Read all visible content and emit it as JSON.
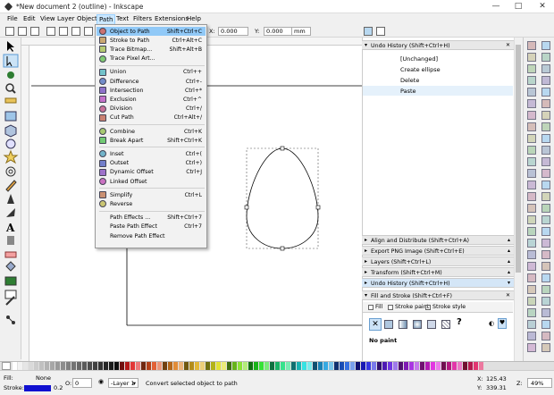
{
  "window": {
    "title": "*New document 2 (outline) - Inkscape",
    "controls": [
      "—",
      "□",
      "✕"
    ]
  },
  "menubar": [
    {
      "label": "File"
    },
    {
      "label": "Edit"
    },
    {
      "label": "View"
    },
    {
      "label": "Layer"
    },
    {
      "label": "Object"
    },
    {
      "label": "Path"
    },
    {
      "label": "Text"
    },
    {
      "label": "Filters"
    },
    {
      "label": "Extensions"
    },
    {
      "label": "Help"
    }
  ],
  "toolbar": {
    "x_label": "X:",
    "x_value": "0.000",
    "y_label": "Y:",
    "y_value": "0.000",
    "unit": "mm"
  },
  "path_menu": [
    {
      "label": "Object to Path",
      "shortcut": "Shift+Ctrl+C",
      "icon": "object-to-path-icon",
      "highlighted": true
    },
    {
      "label": "Stroke to Path",
      "shortcut": "Ctrl+Alt+C",
      "icon": "stroke-to-path-icon"
    },
    {
      "label": "Trace Bitmap...",
      "shortcut": "Shift+Alt+B",
      "icon": "trace-bitmap-icon"
    },
    {
      "label": "Trace Pixel Art...",
      "shortcut": "",
      "icon": "trace-pixel-art-icon"
    },
    {
      "sep": true
    },
    {
      "label": "Union",
      "shortcut": "Ctrl++",
      "icon": "union-icon"
    },
    {
      "label": "Difference",
      "shortcut": "Ctrl+-",
      "icon": "difference-icon"
    },
    {
      "label": "Intersection",
      "shortcut": "Ctrl+*",
      "icon": "intersection-icon"
    },
    {
      "label": "Exclusion",
      "shortcut": "Ctrl+^",
      "icon": "exclusion-icon"
    },
    {
      "label": "Division",
      "shortcut": "Ctrl+/",
      "icon": "division-icon"
    },
    {
      "label": "Cut Path",
      "shortcut": "Ctrl+Alt+/",
      "icon": "cut-path-icon"
    },
    {
      "sep": true
    },
    {
      "label": "Combine",
      "shortcut": "Ctrl+K",
      "icon": "combine-icon"
    },
    {
      "label": "Break Apart",
      "shortcut": "Shift+Ctrl+K",
      "icon": "break-apart-icon"
    },
    {
      "sep": true
    },
    {
      "label": "Inset",
      "shortcut": "Ctrl+(",
      "icon": "inset-icon"
    },
    {
      "label": "Outset",
      "shortcut": "Ctrl+)",
      "icon": "outset-icon"
    },
    {
      "label": "Dynamic Offset",
      "shortcut": "Ctrl+J",
      "icon": "dynamic-offset-icon"
    },
    {
      "label": "Linked Offset",
      "shortcut": "",
      "icon": "linked-offset-icon"
    },
    {
      "sep": true
    },
    {
      "label": "Simplify",
      "shortcut": "Ctrl+L",
      "icon": "simplify-icon"
    },
    {
      "label": "Reverse",
      "shortcut": "",
      "icon": "reverse-icon"
    },
    {
      "sep": true
    },
    {
      "label": "Path Effects ...",
      "shortcut": "Shift+Ctrl+7",
      "icon": ""
    },
    {
      "label": "Paste Path Effect",
      "shortcut": "Ctrl+7",
      "icon": ""
    },
    {
      "label": "Remove Path Effect",
      "shortcut": "",
      "icon": ""
    }
  ],
  "undo_history": {
    "title": "Undo History (Shift+Ctrl+H)",
    "items": [
      {
        "label": "[Unchanged]"
      },
      {
        "label": "Create ellipse"
      },
      {
        "label": "Delete"
      },
      {
        "label": "Paste"
      }
    ]
  },
  "dock_headers": [
    {
      "label": "Align and Distribute (Shift+Ctrl+A)"
    },
    {
      "label": "Export PNG Image (Shift+Ctrl+E)"
    },
    {
      "label": "Layers (Shift+Ctrl+L)"
    },
    {
      "label": "Transform (Shift+Ctrl+M)"
    },
    {
      "label": "Undo History (Shift+Ctrl+H)"
    }
  ],
  "fill_stroke": {
    "title": "Fill and Stroke (Shift+Ctrl+F)",
    "tabs": [
      {
        "label": "Fill"
      },
      {
        "label": "Stroke paint"
      },
      {
        "label": "Stroke style"
      }
    ],
    "paint_state": "No paint"
  },
  "status": {
    "fill_label": "Fill:",
    "fill_value": "None",
    "stroke_label": "Stroke:",
    "stroke_width": "0.2",
    "opacity_label": "O:",
    "opacity_value": "0",
    "layer": "-Layer 1",
    "message": "Convert selected object to path",
    "x_label": "X:",
    "x_coord": "125.43",
    "y_label": "Y:",
    "y_coord": "339.31",
    "zoom_label": "Z:",
    "zoom": "49%"
  },
  "colors": {
    "accent": "#91c9f7",
    "menu_active": "#cce8ff"
  }
}
